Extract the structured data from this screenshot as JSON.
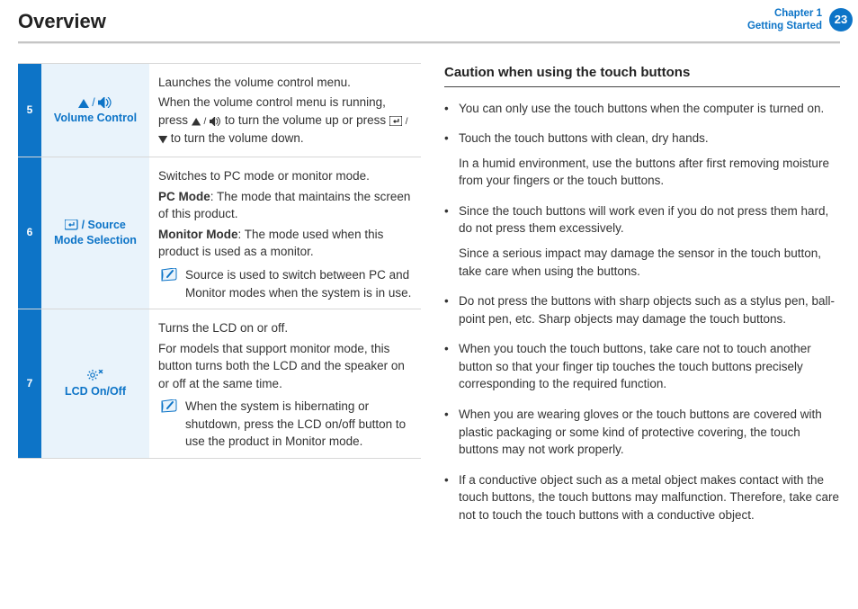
{
  "header": {
    "title": "Overview",
    "chapter_line1": "Chapter 1",
    "chapter_line2": "Getting Started",
    "page": "23"
  },
  "table": {
    "rows": [
      {
        "num": "5",
        "label_line2": "Volume Control",
        "p1": "Launches the volume control menu.",
        "p2a": "When the volume control menu is running, press ",
        "p2b": " to turn the volume up or press ",
        "p2c": " to turn the volume down."
      },
      {
        "num": "6",
        "label_suffix": " / Source",
        "label_line2": "Mode Selection",
        "p1": "Switches to PC mode or monitor mode.",
        "p2_bold": "PC Mode",
        "p2_rest": ": The mode that maintains the screen of this product.",
        "p3_bold": "Monitor Mode",
        "p3_rest": ": The mode used when this product is used as a monitor.",
        "note": "Source is used to switch between PC and Monitor modes when the system is in use."
      },
      {
        "num": "7",
        "label_line2": "LCD On/Off",
        "p1": "Turns the LCD on or off.",
        "p2": "For models that support monitor mode, this button turns both the LCD and the speaker on or off at the same time.",
        "note": "When the system is hibernating or shutdown, press the LCD on/off button to use the product in Monitor mode."
      }
    ]
  },
  "right": {
    "heading": "Caution when using the touch buttons",
    "items": [
      {
        "t": "You can only use the touch buttons when the computer is turned on."
      },
      {
        "t": "Touch the touch buttons with clean, dry hands.",
        "sub": "In a humid environment, use the buttons after first removing moisture from your fingers or the touch buttons."
      },
      {
        "t": "Since the touch buttons will work even if you do not press them hard, do not press them excessively.",
        "sub": "Since a serious impact may damage the sensor in the touch button, take care when using the buttons."
      },
      {
        "t": "Do not press the buttons with sharp objects such as a stylus pen, ball-point pen, etc. Sharp objects may damage the touch buttons."
      },
      {
        "t": "When you touch the touch buttons, take care not to touch another button so that your finger tip touches the touch buttons precisely corresponding to the required function."
      },
      {
        "t": "When you are wearing gloves or the touch buttons are covered with plastic packaging or some kind of protective covering, the touch buttons may not work properly."
      },
      {
        "t": "If a conductive object such as a metal object makes contact with the touch buttons, the touch buttons may malfunction. Therefore, take care not to touch the touch buttons with a conductive object."
      }
    ]
  }
}
